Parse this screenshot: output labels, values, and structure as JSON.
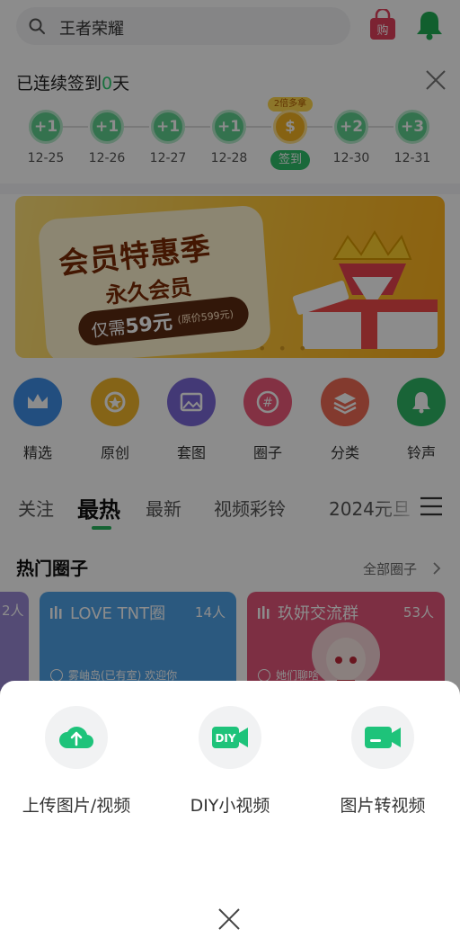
{
  "search": {
    "query": "王者荣耀"
  },
  "checkin": {
    "title_prefix": "已连续签到",
    "days_count": "0",
    "title_suffix": "天",
    "badge": "2倍多拿",
    "days": [
      {
        "reward": "+1",
        "date": "12-25"
      },
      {
        "reward": "+1",
        "date": "12-26"
      },
      {
        "reward": "+1",
        "date": "12-27"
      },
      {
        "reward": "+1",
        "date": "12-28"
      },
      {
        "reward": "$",
        "date": "签到",
        "today": true
      },
      {
        "reward": "+2",
        "date": "12-30"
      },
      {
        "reward": "+3",
        "date": "12-31"
      }
    ]
  },
  "banner": {
    "title": "会员特惠季",
    "subtitle": "永久会员",
    "price_prefix": "仅需",
    "price": "59元",
    "original": "(原价599元)"
  },
  "categories": [
    {
      "label": "精选",
      "icon": "crown-icon",
      "color": "#3f8ee8"
    },
    {
      "label": "原创",
      "icon": "medal-icon",
      "color": "#f3b62a"
    },
    {
      "label": "套图",
      "icon": "picture-icon",
      "color": "#7a68d8"
    },
    {
      "label": "圈子",
      "icon": "hash-icon",
      "color": "#ef5a7a"
    },
    {
      "label": "分类",
      "icon": "layers-icon",
      "color": "#ef6a55"
    },
    {
      "label": "铃声",
      "icon": "bell-icon",
      "color": "#2eb765"
    }
  ],
  "tabs": [
    "关注",
    "最热",
    "最新",
    "视频彩铃",
    "2024元旦"
  ],
  "hot": {
    "title": "热门圈子",
    "all_label": "全部圈子",
    "left_count": "2人",
    "cards": [
      {
        "name": "LOVE TNT圈",
        "count": "14人",
        "msg": "雾岫岛(已有室) 欢迎你"
      },
      {
        "name": "玖妍交流群",
        "count": "53人",
        "msg": "她们聊啥"
      }
    ]
  },
  "sheet": {
    "actions": [
      {
        "label": "上传图片/视频",
        "icon": "cloud-upload-icon"
      },
      {
        "label": "DIY小视频",
        "icon": "diy-video-icon"
      },
      {
        "label": "图片转视频",
        "icon": "video-camera-icon"
      }
    ]
  },
  "colors": {
    "brand_green": "#2ebf6a",
    "accent_red": "#e2405c"
  }
}
